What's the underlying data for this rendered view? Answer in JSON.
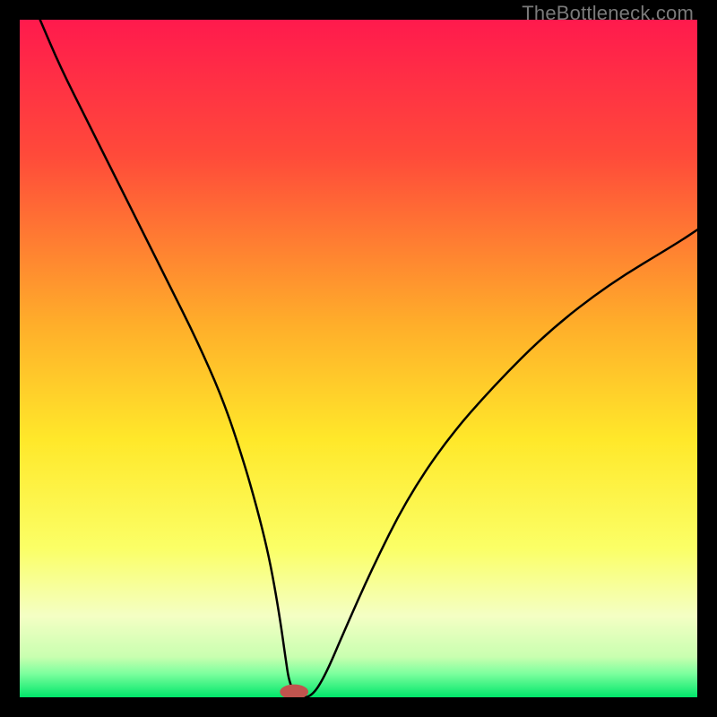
{
  "watermark": "TheBottleneck.com",
  "chart_data": {
    "type": "line",
    "title": "",
    "xlabel": "",
    "ylabel": "",
    "xlim": [
      0,
      100
    ],
    "ylim": [
      0,
      100
    ],
    "grid": false,
    "legend": false,
    "background_gradient": {
      "stops": [
        {
          "pos": 0.0,
          "color": "#ff1a4d"
        },
        {
          "pos": 0.2,
          "color": "#ff4a3a"
        },
        {
          "pos": 0.45,
          "color": "#ffae2a"
        },
        {
          "pos": 0.62,
          "color": "#ffe82a"
        },
        {
          "pos": 0.78,
          "color": "#fbff66"
        },
        {
          "pos": 0.88,
          "color": "#f4ffc4"
        },
        {
          "pos": 0.94,
          "color": "#c9ffb0"
        },
        {
          "pos": 0.965,
          "color": "#7dff9e"
        },
        {
          "pos": 1.0,
          "color": "#00e66a"
        }
      ]
    },
    "series": [
      {
        "name": "curve",
        "color": "#000000",
        "stroke_width": 2.5,
        "x": [
          3,
          6,
          10,
          14,
          18,
          22,
          26,
          30,
          33,
          35,
          36.5,
          37.5,
          38.5,
          39.2,
          39.8,
          41,
          43,
          45,
          48,
          52,
          57,
          63,
          70,
          78,
          87,
          97,
          100
        ],
        "y": [
          100,
          93,
          85,
          77,
          69,
          61,
          53,
          44,
          35,
          28,
          22,
          17,
          11,
          6,
          2,
          0,
          0,
          3,
          10,
          19,
          29,
          38,
          46,
          54,
          61,
          67,
          69
        ]
      }
    ],
    "marker": {
      "name": "min-point",
      "x": 40.5,
      "y": 0.8,
      "rx": 2.1,
      "ry": 1.1,
      "color": "#c0544e"
    }
  }
}
